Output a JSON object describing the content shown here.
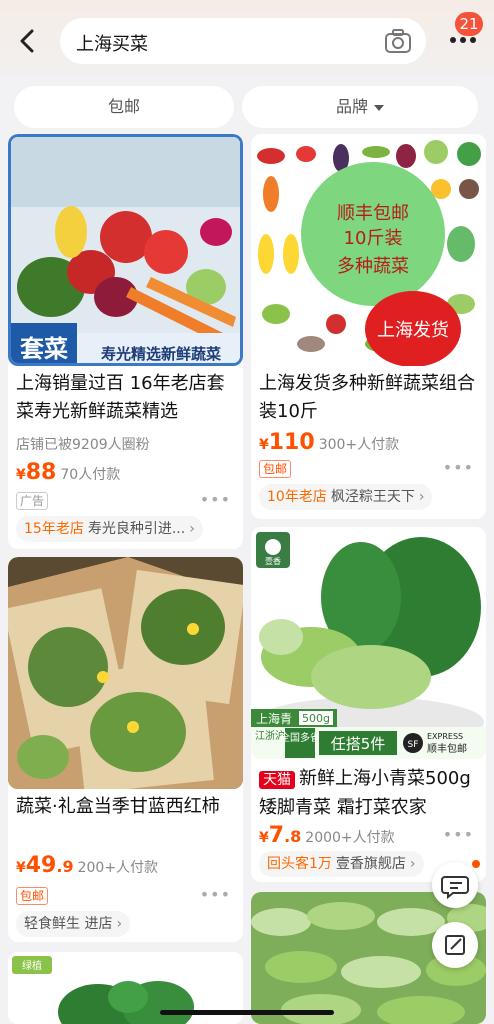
{
  "header": {
    "search_query": "上海买菜",
    "message_count": "21"
  },
  "filters": [
    {
      "label": "包邮"
    },
    {
      "label": "品牌"
    }
  ],
  "products": [
    {
      "image_caption": "套菜",
      "image_subcaption": "寿光精选新鲜蔬菜",
      "title": "上海销量过百 16年老店套菜寿光新鲜蔬菜精选",
      "fans": "店铺已被9209人圈粉",
      "price_symbol": "¥",
      "price_int": "88",
      "price_dec": "",
      "sold": "70人付款",
      "tag": "广告",
      "shop_highlight": "15年老店",
      "shop_name": "寿光良种引进..."
    },
    {
      "image_bubble_line1": "顺丰包邮",
      "image_bubble_line2": "10斤装",
      "image_bubble_line3": "多种蔬菜",
      "image_stamp": "上海发货",
      "title": "上海发货多种新鲜蔬菜组合装10斤",
      "price_symbol": "¥",
      "price_int": "110",
      "price_dec": "",
      "sold": "300+人付款",
      "tag": "包邮",
      "shop_highlight": "10年老店",
      "shop_name": "枫泾粽王天下"
    },
    {
      "title": "蔬菜·礼盒当季甘蓝西红柿",
      "price_symbol": "¥",
      "price_int": "49",
      "price_dec": ".9",
      "sold": "200+人付款",
      "tag": "包邮",
      "shop_name": "轻食鲜生 进店"
    },
    {
      "image_logo": "壹香",
      "image_label": "上海青",
      "image_weight": "500g",
      "image_region": "江浙沪皖",
      "image_region2": "全国多省",
      "image_promo": "任搭5件",
      "image_express_top": "EXPRESS",
      "image_express": "顺丰包邮",
      "tmall": "天猫",
      "title": "新鲜上海小青菜500g 矮脚青菜 霜打菜农家",
      "price_symbol": "¥",
      "price_int": "7",
      "price_dec": ".8",
      "sold": "2000+人付款",
      "shop_highlight": "回头客1万",
      "shop_name": "壹香旗舰店"
    },
    {
      "image_logo": "绿植"
    }
  ],
  "colors": {
    "accent": "#ff5000",
    "badge": "#f4533a",
    "tmall": "#e5001c",
    "bubble_green": "#7ed67e",
    "stamp_red": "#e02020"
  }
}
